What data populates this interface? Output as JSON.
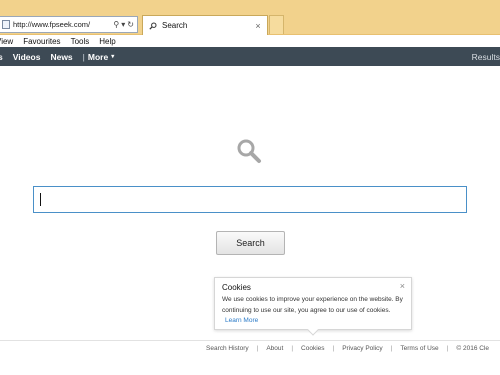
{
  "browser": {
    "url": "http://www.fpseek.com/",
    "address_buttons": [
      "⚲",
      "▾",
      "↻"
    ],
    "tab_title": "Search",
    "tab_close": "×"
  },
  "menu": {
    "items": [
      "View",
      "Favourites",
      "Tools",
      "Help"
    ]
  },
  "site_nav": {
    "items": [
      "s",
      "Videos",
      "News"
    ],
    "separator": "|",
    "more_label": "More",
    "more_caret": "▾",
    "results_label": "Results"
  },
  "search": {
    "input_value": "",
    "button_label": "Search"
  },
  "cookie": {
    "title": "Cookies",
    "text": "We use cookies to improve your experience on the website. By continuing to use our site, you agree to our use of cookies.",
    "link_label": "Learn More",
    "close": "×"
  },
  "footer": {
    "links": [
      "Search History",
      "About",
      "Cookies",
      "Privacy Policy",
      "Terms of Use"
    ],
    "separator": "|",
    "copyright": "© 2016 Cle"
  },
  "colors": {
    "chrome": "#f2d28c",
    "nav_bar": "#3d4a55",
    "input_border": "#4a90c8",
    "link": "#2a7ac7"
  }
}
